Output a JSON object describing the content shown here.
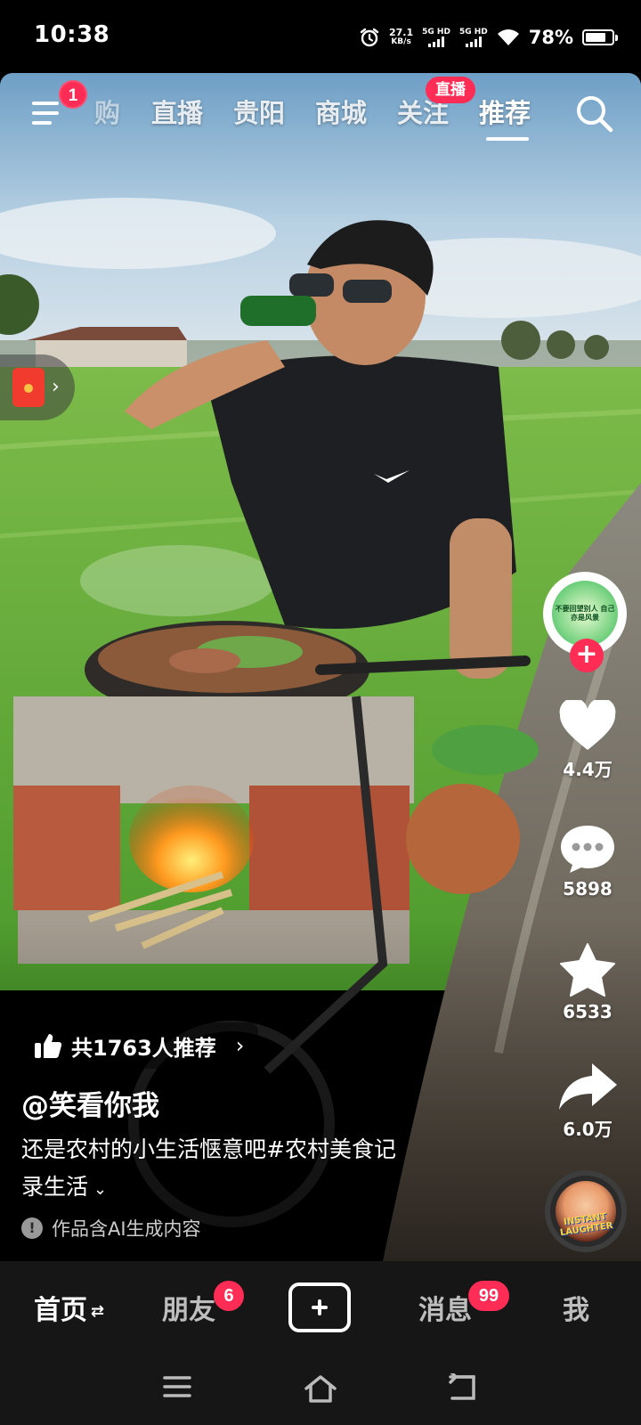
{
  "status_bar": {
    "time": "10:38",
    "net_speed_value": "27.1",
    "net_speed_unit": "KB/s",
    "sim1_label": "5G HD",
    "sim2_label": "5G HD",
    "battery_percent": "78%",
    "battery_level": 0.78,
    "icons": [
      "alarm-icon",
      "signal-icon",
      "wifi-icon",
      "battery-icon"
    ]
  },
  "top_nav": {
    "menu_badge": "1",
    "tabs": [
      {
        "label": "购"
      },
      {
        "label": "直播"
      },
      {
        "label": "贵阳"
      },
      {
        "label": "商城"
      },
      {
        "label": "关注",
        "badge": "直播"
      },
      {
        "label": "推荐",
        "active": true
      }
    ],
    "search_icon": "search-icon"
  },
  "side_rail": {
    "follow_avatar_text": "不要回望别人 自己亦是风景",
    "likes": "4.4万",
    "comments": "5898",
    "favorites": "6533",
    "shares": "6.0万",
    "music_disc_text": "INSTANT LAUGHTER"
  },
  "post": {
    "recommend_text": "共1763人推荐",
    "author": "@笑看你我",
    "caption_line1": "还是农村的小生活惬意吧#农村美食记",
    "caption_line2": "录生活",
    "ai_notice": "作品含AI生成内容"
  },
  "bottom_tabs": [
    {
      "label": "首页",
      "active": true
    },
    {
      "label": "朋友",
      "badge": "6"
    },
    {
      "label": "消息",
      "badge": "99"
    },
    {
      "label": "我"
    }
  ],
  "colors": {
    "accent_red": "#ff2c55",
    "tab_bar_bg": "#161616"
  }
}
